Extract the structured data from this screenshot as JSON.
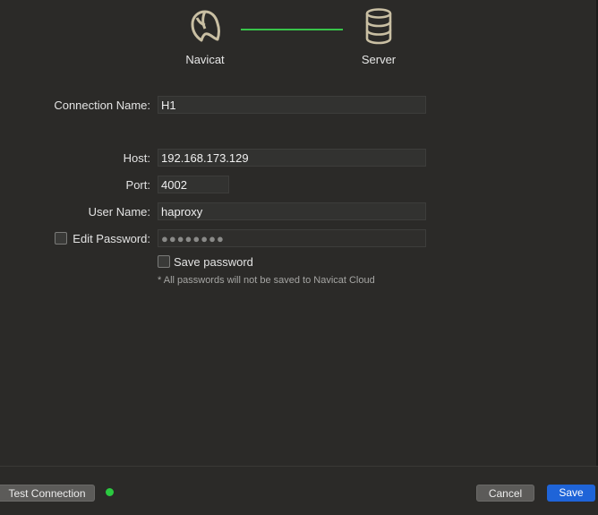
{
  "header": {
    "left_label": "Navicat",
    "left_icon": "navicat-dolphin-icon",
    "right_label": "Server",
    "right_icon": "database-icon",
    "connector_color": "#38c44a"
  },
  "form": {
    "connection_name": {
      "label": "Connection Name:",
      "value": "H1"
    },
    "host": {
      "label": "Host:",
      "value": "192.168.173.129"
    },
    "port": {
      "label": "Port:",
      "value": "4002"
    },
    "user_name": {
      "label": "User Name:",
      "value": "haproxy"
    },
    "edit_password": {
      "label": "Edit Password:",
      "checked": false,
      "value": "●●●●●●●●"
    },
    "save_password": {
      "label": "Save password",
      "checked": false
    },
    "note": "* All passwords will not be saved to Navicat Cloud"
  },
  "footer": {
    "test_connection_label": "Test Connection",
    "status_color": "#2bc940",
    "cancel_label": "Cancel",
    "save_label": "Save",
    "accent": "#1f64d8"
  }
}
